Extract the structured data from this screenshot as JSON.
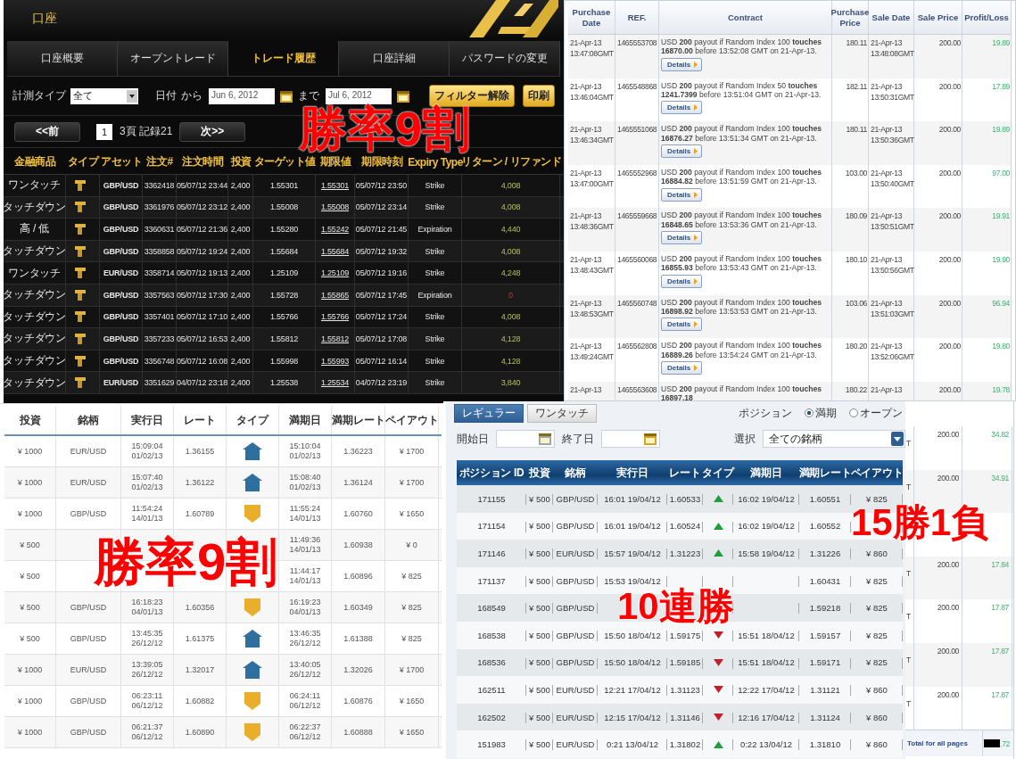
{
  "account_panel": {
    "title": "口座",
    "tabs": [
      {
        "label": "口座概要",
        "selected": false
      },
      {
        "label": "オープントレード",
        "selected": false
      },
      {
        "label": "トレード履歴",
        "selected": true
      },
      {
        "label": "口座詳細",
        "selected": false
      },
      {
        "label": "パスワードの変更",
        "selected": false
      }
    ],
    "filter": {
      "type_label": "計測タイプ",
      "type_value": "全て",
      "date_label": "日付",
      "from_label": "から",
      "from_value": "Jun 6, 2012",
      "to_label": "まで",
      "to_value": "Jul 6, 2012",
      "clear_button": "フィルター解除",
      "print_button": "印刷"
    },
    "pager": {
      "prev_button": "<<前",
      "page": "1",
      "info": "3頁 記録21",
      "next_button": "次>>"
    },
    "columns": [
      "金融商品",
      "タイプ",
      "アセット",
      "注文#",
      "注文時間",
      "投資",
      "ターゲット値",
      "期限値",
      "期限時刻",
      "Expiry Type",
      "リターン / リファンド"
    ],
    "rows": [
      {
        "product": "ワンタッチ",
        "asset": "GBP/USD",
        "order": "3362418",
        "time": "05/07/12 23:44",
        "invest": "2,400",
        "target": "1.55301",
        "expiry_value": "1.55301",
        "expiry_time": "05/07/12 23:50",
        "expiry_type": "Strike",
        "return": "4,008",
        "loss": false
      },
      {
        "product": "タッチダウン",
        "asset": "GBP/USD",
        "order": "3361976",
        "time": "05/07/12 23:12",
        "invest": "2,400",
        "target": "1.55008",
        "expiry_value": "1.55008",
        "expiry_time": "05/07/12 23:14",
        "expiry_type": "Strike",
        "return": "4,008",
        "loss": false
      },
      {
        "product": "高 / 低",
        "asset": "GBP/USD",
        "order": "3360631",
        "time": "05/07/12 21:36",
        "invest": "2,400",
        "target": "1.55280",
        "expiry_value": "1.55242",
        "expiry_time": "05/07/12 21:45",
        "expiry_type": "Expiration",
        "return": "4,440",
        "loss": false
      },
      {
        "product": "タッチダウン",
        "asset": "GBP/USD",
        "order": "3358858",
        "time": "05/07/12 19:24",
        "invest": "2,400",
        "target": "1.55684",
        "expiry_value": "1.55684",
        "expiry_time": "05/07/12 19:32",
        "expiry_type": "Strike",
        "return": "4,008",
        "loss": false
      },
      {
        "product": "ワンタッチ",
        "asset": "EUR/USD",
        "order": "3358714",
        "time": "05/07/12 19:13",
        "invest": "2,400",
        "target": "1.25109",
        "expiry_value": "1.25109",
        "expiry_time": "05/07/12 19:16",
        "expiry_type": "Strike",
        "return": "4,248",
        "loss": false
      },
      {
        "product": "タッチダウン",
        "asset": "GBP/USD",
        "order": "3357563",
        "time": "05/07/12 17:30",
        "invest": "2,400",
        "target": "1.55728",
        "expiry_value": "1.55865",
        "expiry_time": "05/07/12 17:45",
        "expiry_type": "Expiration",
        "return": "0",
        "loss": true
      },
      {
        "product": "タッチダウン",
        "asset": "GBP/USD",
        "order": "3357401",
        "time": "05/07/12 17:10",
        "invest": "2,400",
        "target": "1.55766",
        "expiry_value": "1.55766",
        "expiry_time": "05/07/12 17:24",
        "expiry_type": "Strike",
        "return": "4,008",
        "loss": false
      },
      {
        "product": "タッチダウン",
        "asset": "GBP/USD",
        "order": "3357233",
        "time": "05/07/12 16:53",
        "invest": "2,400",
        "target": "1.55812",
        "expiry_value": "1.55812",
        "expiry_time": "05/07/12 17:08",
        "expiry_type": "Strike",
        "return": "4,128",
        "loss": false
      },
      {
        "product": "タッチダウン",
        "asset": "GBP/USD",
        "order": "3356748",
        "time": "05/07/12 16:08",
        "invest": "2,400",
        "target": "1.55998",
        "expiry_value": "1.55993",
        "expiry_time": "05/07/12 16:14",
        "expiry_type": "Strike",
        "return": "4,128",
        "loss": false
      },
      {
        "product": "タッチダウン",
        "asset": "EUR/USD",
        "order": "3351629",
        "time": "04/07/12 23:18",
        "invest": "2,400",
        "target": "1.25538",
        "expiry_value": "1.25534",
        "expiry_time": "04/07/12 23:19",
        "expiry_type": "Strike",
        "return": "3,840",
        "loss": false
      }
    ]
  },
  "statement": {
    "columns": [
      "Purchase Date",
      "REF.",
      "Contract",
      "Purchase Price",
      "Sale Date",
      "Sale Price",
      "Profit/Loss"
    ],
    "rows": [
      {
        "purchase_date": "21-Apr-13",
        "purchase_time": "13:47:08GMT",
        "ref": "1465553708",
        "contract": "USD **200** payout if Random Index 100 **touches 16870.00** before 13:52:08 GMT on 21-Apr-13.",
        "details": "Details",
        "purchase_price": "180.11",
        "sale_date": "21-Apr-13",
        "sale_time": "13:48:08GMT",
        "sale_price": "200.00",
        "profit": "19.89"
      },
      {
        "purchase_date": "21-Apr-13",
        "purchase_time": "13:46:04GMT",
        "ref": "1465548868",
        "contract": "USD **200** payout if Random Index 50 **touches 1241.7399** before 13:51:04 GMT on 21-Apr-13.",
        "details": "Details",
        "purchase_price": "182.11",
        "sale_date": "21-Apr-13",
        "sale_time": "13:50:31GMT",
        "sale_price": "200.00",
        "profit": "17.89"
      },
      {
        "purchase_date": "21-Apr-13",
        "purchase_time": "13:46:34GMT",
        "ref": "1465551068",
        "contract": "USD **200** payout if Random Index 100 **touches 16876.27** before 13:51:34 GMT on 21-Apr-13.",
        "details": "Details",
        "purchase_price": "180.11",
        "sale_date": "21-Apr-13",
        "sale_time": "13:50:36GMT",
        "sale_price": "200.00",
        "profit": "19.89"
      },
      {
        "purchase_date": "21-Apr-13",
        "purchase_time": "13:47:00GMT",
        "ref": "1465552968",
        "contract": "USD **200** payout if Random Index 100 **touches 16884.82** before 13:51:59 GMT on 21-Apr-13.",
        "details": "Details",
        "purchase_price": "103.00",
        "sale_date": "21-Apr-13",
        "sale_time": "13:50:40GMT",
        "sale_price": "200.00",
        "profit": "97.00"
      },
      {
        "purchase_date": "21-Apr-13",
        "purchase_time": "13:48:36GMT",
        "ref": "1465559668",
        "contract": "USD **200** payout if Random Index 100 **touches 16848.65** before 13:53:36 GMT on 21-Apr-13.",
        "details": "Details",
        "purchase_price": "180.09",
        "sale_date": "21-Apr-13",
        "sale_time": "13:50:51GMT",
        "sale_price": "200.00",
        "profit": "19.91"
      },
      {
        "purchase_date": "21-Apr-13",
        "purchase_time": "13:48:43GMT",
        "ref": "1465560068",
        "contract": "USD **200** payout if Random Index 100 **touches 16855.93** before 13:53:43 GMT on 21-Apr-13.",
        "details": "Details",
        "purchase_price": "180.10",
        "sale_date": "21-Apr-13",
        "sale_time": "13:50:56GMT",
        "sale_price": "200.00",
        "profit": "19.90"
      },
      {
        "purchase_date": "21-Apr-13",
        "purchase_time": "13:48:53GMT",
        "ref": "1465560748",
        "contract": "USD **200** payout if Random Index 100 **touches 16898.92** before 13:53:53 GMT on 21-Apr-13.",
        "details": "Details",
        "purchase_price": "103.06",
        "sale_date": "21-Apr-13",
        "sale_time": "13:51:03GMT",
        "sale_price": "200.00",
        "profit": "96.94"
      },
      {
        "purchase_date": "21-Apr-13",
        "purchase_time": "13:49:24GMT",
        "ref": "1465562808",
        "contract": "USD **200** payout if Random Index 100 **touches 16889.26** before 13:54:24 GMT on 21-Apr-13.",
        "details": "Details",
        "purchase_price": "180.20",
        "sale_date": "21-Apr-13",
        "sale_time": "13:52:06GMT",
        "sale_price": "200.00",
        "profit": "19.80"
      },
      {
        "purchase_date": "21-Apr-13",
        "ref": "1465563608",
        "contract": "USD **200** payout if Random Index 100 **touches 16897.18**",
        "purchase_price": "180.22",
        "sale_date": "21-Apr-13",
        "sale_price": "200.00",
        "profit": "19.78"
      }
    ],
    "lower_rows": [
      {
        "sale_time_tail": "T",
        "sale_price": "200.00",
        "profit": "34.82"
      },
      {
        "sale_time_tail": "T",
        "sale_price": "200.00",
        "profit": "34.91"
      },
      {},
      {
        "sale_time_tail": "T",
        "sale_price": "200.00",
        "profit": "17.84"
      },
      {
        "sale_time_tail": "T",
        "sale_price": "200.00",
        "profit": "17.87"
      },
      {
        "sale_time_tail": "T",
        "sale_price": "200.00",
        "profit": "17.87"
      },
      {
        "sale_time_tail": "T",
        "sale_price": "200.00",
        "profit": "17.87"
      }
    ],
    "total_label": "Total for all pages",
    "total_value": ".72"
  },
  "trade_list": {
    "columns": [
      "投資",
      "銘柄",
      "実行日",
      "レート",
      "タイプ",
      "満期日",
      "満期レート",
      "ペイアウト"
    ],
    "rows": [
      {
        "invest": "¥ 1000",
        "symbol": "EUR/USD",
        "exec_time": "15:09:04",
        "exec_date": "01/02/13",
        "rate": "1.36155",
        "kind": "up",
        "expiry_time": "15:10:04",
        "expiry_date": "01/02/13",
        "expiry_rate": "1.36223",
        "payout": "¥ 1700"
      },
      {
        "invest": "¥ 1000",
        "symbol": "EUR/USD",
        "exec_time": "15:07:40",
        "exec_date": "01/02/13",
        "rate": "1.36122",
        "kind": "up",
        "expiry_time": "15:08:40",
        "expiry_date": "01/02/13",
        "expiry_rate": "1.36124",
        "payout": "¥ 1700"
      },
      {
        "invest": "¥ 1000",
        "symbol": "GBP/USD",
        "exec_time": "11:54:24",
        "exec_date": "14/01/13",
        "rate": "1.60789",
        "kind": "down",
        "expiry_time": "11:55:24",
        "expiry_date": "14/01/13",
        "expiry_rate": "1.60760",
        "payout": "¥ 1650"
      },
      {
        "invest": "¥ 500",
        "expiry_time": "11:49:36",
        "expiry_date": "14/01/13",
        "expiry_rate": "1.60938",
        "payout": "¥ 0"
      },
      {
        "invest": "¥ 500",
        "expiry_time": "11:44:17",
        "expiry_date": "14/01/13",
        "expiry_rate": "1.60896",
        "payout": "¥ 825"
      },
      {
        "invest": "¥ 500",
        "symbol": "GBP/USD",
        "exec_time": "16:18:23",
        "exec_date": "04/01/13",
        "rate": "1.60356",
        "kind": "down",
        "expiry_time": "16:19:23",
        "expiry_date": "04/01/13",
        "expiry_rate": "1.60349",
        "payout": "¥ 825"
      },
      {
        "invest": "¥ 500",
        "symbol": "GBP/USD",
        "exec_time": "13:45:35",
        "exec_date": "26/12/12",
        "rate": "1.61375",
        "kind": "up",
        "expiry_time": "13:46:35",
        "expiry_date": "26/12/12",
        "expiry_rate": "1.61388",
        "payout": "¥ 825"
      },
      {
        "invest": "¥ 1000",
        "symbol": "EUR/USD",
        "exec_time": "13:39:05",
        "exec_date": "26/12/12",
        "rate": "1.32017",
        "kind": "up",
        "expiry_time": "13:40:05",
        "expiry_date": "26/12/12",
        "expiry_rate": "1.32026",
        "payout": "¥ 1700"
      },
      {
        "invest": "¥ 1000",
        "symbol": "GBP/USD",
        "exec_time": "06:23:11",
        "exec_date": "06/12/12",
        "rate": "1.60882",
        "kind": "down",
        "expiry_time": "06:24:11",
        "expiry_date": "06/12/12",
        "expiry_rate": "1.60876",
        "payout": "¥ 1650"
      },
      {
        "invest": "¥ 1000",
        "symbol": "GBP/USD",
        "exec_time": "06:21:37",
        "exec_date": "06/12/12",
        "rate": "1.60890",
        "kind": "down",
        "expiry_time": "06:22:37",
        "expiry_date": "06/12/12",
        "expiry_rate": "1.60888",
        "payout": "¥ 1650"
      }
    ]
  },
  "position_panel": {
    "tabs": [
      {
        "label": "レギュラー",
        "selected": true
      },
      {
        "label": "ワンタッチ",
        "selected": false
      }
    ],
    "position_label": "ポジション",
    "radios": [
      {
        "label": "満期",
        "selected": true
      },
      {
        "label": "オープン",
        "selected": false
      }
    ],
    "start_label": "開始日",
    "end_label": "終了日",
    "select_label": "選択",
    "select_value": "全ての銘柄",
    "columns": [
      "ポジション ID",
      "投資",
      "銘柄",
      "実行日",
      "レート",
      "タイプ",
      "満期日",
      "満期レート",
      "ペイアウト"
    ],
    "rows": [
      {
        "id": "171155",
        "invest": "¥ 500",
        "symbol": "GBP/USD",
        "exec": "16:01 19/04/12",
        "rate": "1.60533",
        "kind": "up",
        "expiry": "16:02 19/04/12",
        "expiry_rate": "1.60551",
        "payout": "¥ 825"
      },
      {
        "id": "171154",
        "invest": "¥ 500",
        "symbol": "GBP/USD",
        "exec": "16:01 19/04/12",
        "rate": "1.60524",
        "kind": "up",
        "expiry": "16:02 19/04/12",
        "expiry_rate": "1.60552"
      },
      {
        "id": "171146",
        "invest": "¥ 500",
        "symbol": "EUR/USD",
        "exec": "15:57 19/04/12",
        "rate": "1.31223",
        "kind": "up",
        "expiry": "15:58 19/04/12",
        "expiry_rate": "1.31226",
        "payout": "¥ 860"
      },
      {
        "id": "171137",
        "invest": "¥ 500",
        "symbol": "GBP/USD",
        "exec": "15:53 19/04/12",
        "expiry_rate": "1.60431",
        "payout": "¥ 825"
      },
      {
        "id": "168549",
        "invest": "¥ 500",
        "symbol": "GBP/USD",
        "expiry_rate": "1.59218",
        "payout": "¥ 825"
      },
      {
        "id": "168538",
        "invest": "¥ 500",
        "symbol": "GBP/USD",
        "exec": "15:50 18/04/12",
        "rate": "1.59175",
        "kind": "down",
        "expiry": "15:51 18/04/12",
        "expiry_rate": "1.59157",
        "payout": "¥ 825"
      },
      {
        "id": "168536",
        "invest": "¥ 500",
        "symbol": "GBP/USD",
        "exec": "15:50 18/04/12",
        "rate": "1.59185",
        "kind": "down",
        "expiry": "15:51 18/04/12",
        "expiry_rate": "1.59171",
        "payout": "¥ 825"
      },
      {
        "id": "162511",
        "invest": "¥ 500",
        "symbol": "EUR/USD",
        "exec": "12:21 17/04/12",
        "rate": "1.31123",
        "kind": "down",
        "expiry": "12:22 17/04/12",
        "expiry_rate": "1.31121",
        "payout": "¥ 860"
      },
      {
        "id": "162502",
        "invest": "¥ 500",
        "symbol": "EUR/USD",
        "exec": "12:15 17/04/12",
        "rate": "1.31146",
        "kind": "down",
        "expiry": "12:16 17/04/12",
        "expiry_rate": "1.31124",
        "payout": "¥ 860"
      },
      {
        "id": "151983",
        "invest": "¥ 500",
        "symbol": "EUR/USD",
        "exec": "0:21 13/04/12",
        "rate": "1.31802",
        "kind": "up",
        "expiry": "0:22 13/04/12",
        "expiry_rate": "1.31810",
        "payout": "¥ 860"
      }
    ]
  },
  "captions": [
    "勝率9割",
    "勝率9割",
    "10連勝",
    "15勝1負"
  ]
}
